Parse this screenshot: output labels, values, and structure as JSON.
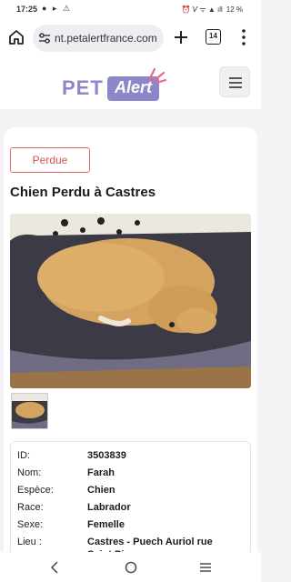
{
  "status_bar": {
    "time": "17:25",
    "left_icons": "● ▸ ⚠",
    "right_icons": "⏰ 𝘝 ᯤ ▲ ıll",
    "battery": "12 %"
  },
  "browser": {
    "url": "nt.petalertfrance.com",
    "tab_count": "14"
  },
  "site": {
    "logo_pet": "PET",
    "logo_alert": "Alert"
  },
  "listing": {
    "status": "Perdue",
    "title": "Chien Perdu à Castres",
    "details": [
      {
        "label": "ID:",
        "value": "3503839"
      },
      {
        "label": "Nom:",
        "value": "Farah"
      },
      {
        "label": "Espèce:",
        "value": "Chien"
      },
      {
        "label": "Race:",
        "value": "Labrador"
      },
      {
        "label": "Sexe:",
        "value": "Femelle"
      },
      {
        "label": "Lieu :",
        "value": "Castres -  Puech Auriol rue"
      },
      {
        "label": "",
        "value": "Saint Pi..."
      }
    ]
  },
  "colors": {
    "brand": "#8b87c9",
    "status_red": "#d9534f"
  }
}
